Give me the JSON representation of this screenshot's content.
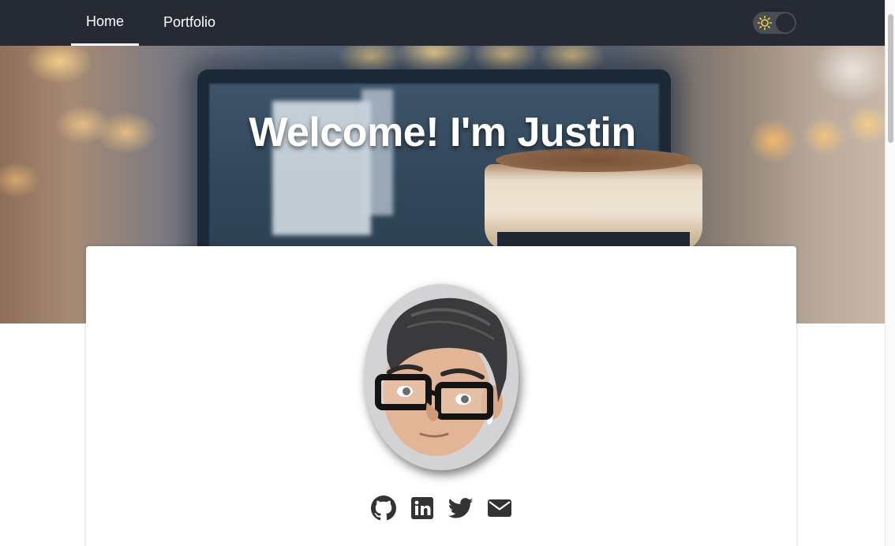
{
  "navbar": {
    "links": [
      {
        "label": "Home",
        "active": true
      },
      {
        "label": "Portfolio",
        "active": false
      }
    ],
    "theme_toggle": {
      "icon": "sun-icon",
      "mode": "light"
    }
  },
  "hero": {
    "title": "Welcome! I'm Justin",
    "background": "blurred laptop and iced coffee photo"
  },
  "profile": {
    "avatar": "memoji-avatar",
    "social_links": [
      {
        "icon": "github-icon"
      },
      {
        "icon": "linkedin-icon"
      },
      {
        "icon": "twitter-icon"
      },
      {
        "icon": "email-icon"
      }
    ]
  },
  "colors": {
    "navbar_bg": "#252a34",
    "text_light": "#ffffff",
    "icon_color": "#333333",
    "card_bg": "#ffffff"
  }
}
